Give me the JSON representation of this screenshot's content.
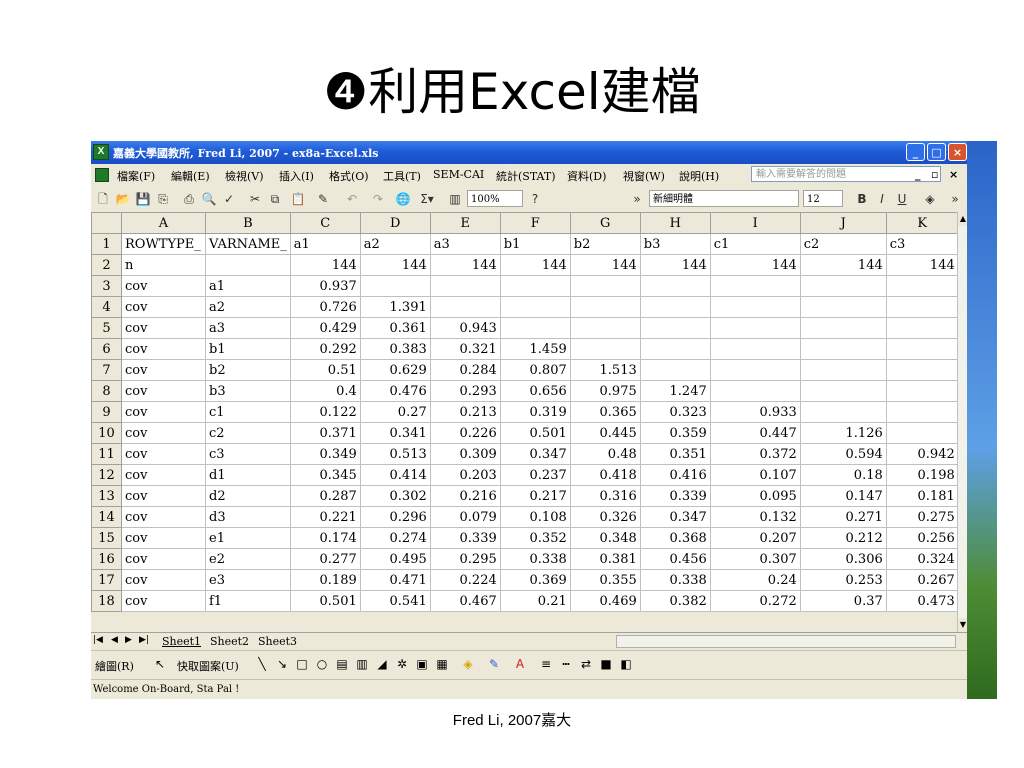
{
  "slide": {
    "title_number": "❹",
    "title_text": "利用Excel建檔",
    "footer": "Fred Li, 2007嘉大"
  },
  "window": {
    "title": "嘉義大學國教所, Fred Li, 2007 - ex8a-Excel.xls",
    "colors": {
      "titlebar": "#1f5bd7",
      "close": "#d8542e",
      "chrome": "#ece9d8"
    }
  },
  "menu": {
    "items": [
      "檔案(F)",
      "編輯(E)",
      "檢視(V)",
      "插入(I)",
      "格式(O)",
      "工具(T)",
      "SEM-CAI",
      "統計(STAT)",
      "資料(D)",
      "視窗(W)",
      "說明(H)"
    ],
    "help_placeholder": "輸入需要解答的問題"
  },
  "toolbar": {
    "zoom": "100%",
    "font": "新細明體",
    "font_size": "12",
    "bold": "B",
    "italic": "I",
    "underline": "U"
  },
  "sheet": {
    "columns": [
      "A",
      "B",
      "C",
      "D",
      "E",
      "F",
      "G",
      "H",
      "I",
      "J",
      "K"
    ],
    "rows": [
      [
        "ROWTYPE_",
        "VARNAME_",
        "a1",
        "a2",
        "a3",
        "b1",
        "b2",
        "b3",
        "c1",
        "c2",
        "c3"
      ],
      [
        "n",
        "",
        "144",
        "144",
        "144",
        "144",
        "144",
        "144",
        "144",
        "144",
        "144"
      ],
      [
        "cov",
        "a1",
        "0.937",
        "",
        "",
        "",
        "",
        "",
        "",
        "",
        ""
      ],
      [
        "cov",
        "a2",
        "0.726",
        "1.391",
        "",
        "",
        "",
        "",
        "",
        "",
        ""
      ],
      [
        "cov",
        "a3",
        "0.429",
        "0.361",
        "0.943",
        "",
        "",
        "",
        "",
        "",
        ""
      ],
      [
        "cov",
        "b1",
        "0.292",
        "0.383",
        "0.321",
        "1.459",
        "",
        "",
        "",
        "",
        ""
      ],
      [
        "cov",
        "b2",
        "0.51",
        "0.629",
        "0.284",
        "0.807",
        "1.513",
        "",
        "",
        "",
        ""
      ],
      [
        "cov",
        "b3",
        "0.4",
        "0.476",
        "0.293",
        "0.656",
        "0.975",
        "1.247",
        "",
        "",
        ""
      ],
      [
        "cov",
        "c1",
        "0.122",
        "0.27",
        "0.213",
        "0.319",
        "0.365",
        "0.323",
        "0.933",
        "",
        ""
      ],
      [
        "cov",
        "c2",
        "0.371",
        "0.341",
        "0.226",
        "0.501",
        "0.445",
        "0.359",
        "0.447",
        "1.126",
        ""
      ],
      [
        "cov",
        "c3",
        "0.349",
        "0.513",
        "0.309",
        "0.347",
        "0.48",
        "0.351",
        "0.372",
        "0.594",
        "0.942"
      ],
      [
        "cov",
        "d1",
        "0.345",
        "0.414",
        "0.203",
        "0.237",
        "0.418",
        "0.416",
        "0.107",
        "0.18",
        "0.198"
      ],
      [
        "cov",
        "d2",
        "0.287",
        "0.302",
        "0.216",
        "0.217",
        "0.316",
        "0.339",
        "0.095",
        "0.147",
        "0.181"
      ],
      [
        "cov",
        "d3",
        "0.221",
        "0.296",
        "0.079",
        "0.108",
        "0.326",
        "0.347",
        "0.132",
        "0.271",
        "0.275"
      ],
      [
        "cov",
        "e1",
        "0.174",
        "0.274",
        "0.339",
        "0.352",
        "0.348",
        "0.368",
        "0.207",
        "0.212",
        "0.256"
      ],
      [
        "cov",
        "e2",
        "0.277",
        "0.495",
        "0.295",
        "0.338",
        "0.381",
        "0.456",
        "0.307",
        "0.306",
        "0.324"
      ],
      [
        "cov",
        "e3",
        "0.189",
        "0.471",
        "0.224",
        "0.369",
        "0.355",
        "0.338",
        "0.24",
        "0.253",
        "0.267"
      ],
      [
        "cov",
        "f1",
        "0.501",
        "0.541",
        "0.467",
        "0.21",
        "0.469",
        "0.382",
        "0.272",
        "0.37",
        "0.473"
      ]
    ],
    "tabs": [
      "Sheet1",
      "Sheet2",
      "Sheet3"
    ],
    "active_tab": "Sheet1"
  },
  "drawing": {
    "draw_label": "繪圖(R)",
    "autoshape_label": "快取圖案(U)"
  },
  "status": {
    "text": "Welcome On-Board, Sta Pal !"
  }
}
